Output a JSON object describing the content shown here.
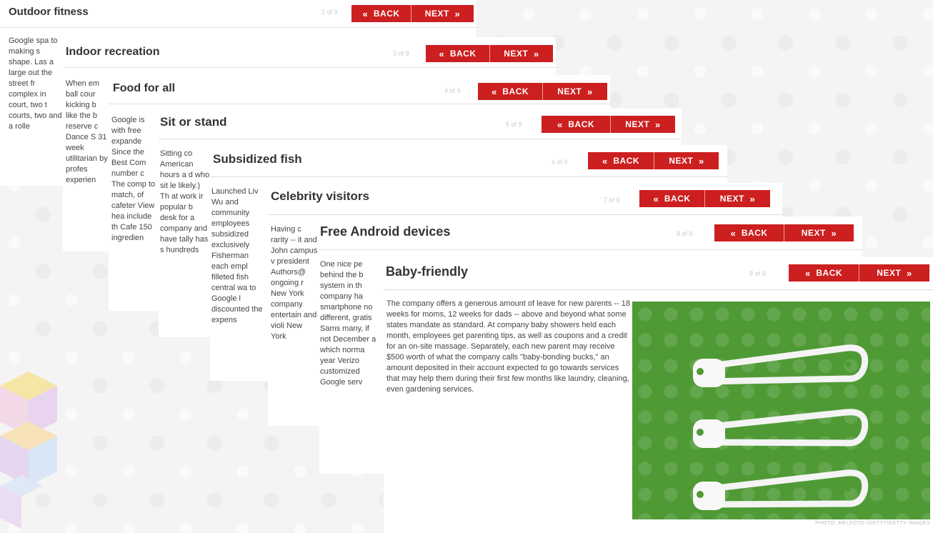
{
  "slides": [
    {
      "title": "Outdoor fitness",
      "counter": "2 of 9",
      "back": "BACK",
      "next": "NEXT",
      "body": "Google spa to making s shape. Las a large out the street fr complex in court, two t courts, two and a rolle"
    },
    {
      "title": "Indoor recreation",
      "counter": "3 of 9",
      "back": "BACK",
      "next": "NEXT",
      "body": "When em ball cour kicking b like the b reserve c Dance S 31 week utilitarian by profes experien"
    },
    {
      "title": "Food for all",
      "counter": "4 of 9",
      "back": "BACK",
      "next": "NEXT",
      "body": "Google is with free expande Since the Best Com number c The comp to match, of cafeter View hea include th Cafe 150 ingredien"
    },
    {
      "title": "Sit or stand",
      "counter": "5 of 9",
      "back": "BACK",
      "next": "NEXT",
      "body": "Sitting co American hours a d who sit le likely.) Th at work ir popular b desk for a company and have tally has s hundreds"
    },
    {
      "title": "Subsidized fish",
      "counter": "6 of 9",
      "back": "BACK",
      "next": "NEXT",
      "body": "Launched Liv Wu and community employees subsidized exclusively Fisherman each empl filleted fish central wa to Google l discounted the expens"
    },
    {
      "title": "Celebrity visitors",
      "counter": "7 of 9",
      "back": "BACK",
      "next": "NEXT",
      "body": "Having c rarity -- it and John campus v president Authors@ ongoing r New York company entertain and violi New York"
    },
    {
      "title": "Free Android devices",
      "counter": "8 of 9",
      "back": "BACK",
      "next": "NEXT",
      "body": "One nice pe behind the b system in th company ha smartphone no different, gratis Sams many, if not December a which norma year Verizo customized Google serv"
    },
    {
      "title": "Baby-friendly",
      "counter": "9 of 9",
      "back": "BACK",
      "next": "NEXT",
      "body": "The company offers a generous amount of leave for new parents -- 18 weeks for moms, 12 weeks for dads -- above and beyond what some states mandate as standard. At company baby showers held each month, employees get parenting tips, as well as coupons and a credit for an on-site massage. Separately, each new parent may receive $500 worth of what the company calls \"baby-bonding bucks,\" an amount deposited in their account expected to go towards services that may help them during their first few months like laundry, cleaning, even gardening services."
    }
  ],
  "photo": {
    "caption": "PHOTO: MELFOTO IGETTY/GETTY IMAGES",
    "background": "#4f9a35"
  },
  "colors": {
    "accent": "#cc1f1f"
  },
  "icons": {
    "back": "chevron-double-left-icon",
    "next": "chevron-double-right-icon"
  }
}
